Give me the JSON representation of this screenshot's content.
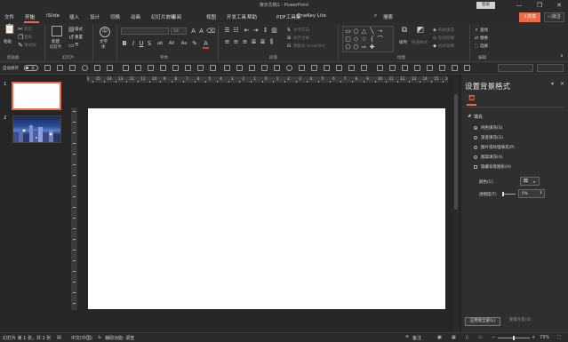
{
  "window": {
    "title": "演示文稿1  -  PowerPoint",
    "login_label": "登录",
    "minimize": "—",
    "restore": "❐",
    "close": "✕"
  },
  "menu": {
    "tabs": [
      "文件",
      "开始",
      "iSlide",
      "插入",
      "设计",
      "切换",
      "动画",
      "幻灯片放映",
      "审阅",
      "视图",
      "开发工具",
      "帮助",
      "PDF工具集",
      "OneKey Lite"
    ],
    "search": "搜索",
    "share": "共享",
    "comment": "批注"
  },
  "ribbon": {
    "clipboard": {
      "group": "剪贴板",
      "paste": "粘贴",
      "cut": "剪切",
      "copy": "复制",
      "format_painter": "格式刷"
    },
    "slides": {
      "group": "幻灯片",
      "new_slide": "新建",
      "new_slide2": "幻灯片",
      "layout": "版式",
      "reset": "重置",
      "section": "节"
    },
    "textfont": {
      "label": "文字",
      "label2": "体"
    },
    "font": {
      "group": "字体",
      "font_name": "",
      "font_size": "18",
      "bold": "B",
      "italic": "I",
      "underline": "U",
      "strike": "S",
      "shadow": "ab",
      "spacing": "AV",
      "case": "Aa",
      "font_color": "A"
    },
    "paragraph": {
      "group": "段落",
      "text_direction": "文字方向",
      "align_text": "对齐文本",
      "smartart": "转换为 SmartArt"
    },
    "drawing": {
      "group": "绘图",
      "arrange": "排列",
      "quick_styles": "快速样式",
      "shape_fill": "形状填充",
      "shape_outline": "形状轮廓",
      "shape_effects": "形状效果"
    },
    "editing": {
      "group": "编辑",
      "find": "查找",
      "replace": "替换",
      "select": "选择"
    }
  },
  "qat": {
    "autosave": "自动保存",
    "toggle": "关"
  },
  "thumbnails": [
    {
      "number": "1"
    },
    {
      "number": "2"
    }
  ],
  "ruler": {
    "h_ticks": [
      "16",
      "15",
      "14",
      "13",
      "12",
      "11",
      "10",
      "9",
      "8",
      "7",
      "6",
      "5",
      "4",
      "3",
      "2",
      "1",
      "0",
      "1",
      "2",
      "3",
      "4",
      "5",
      "6",
      "7",
      "8",
      "9",
      "10",
      "11",
      "12",
      "13",
      "14",
      "15",
      "16"
    ]
  },
  "pane": {
    "title": "设置背景格式",
    "section": "填充",
    "options": [
      "纯色填充(S)",
      "渐变填充(G)",
      "图片或纹理填充(P)",
      "图案填充(A)"
    ],
    "selected_option": 0,
    "hide_bg": "隐藏背景图形(H)",
    "color_label": "颜色(C)",
    "transparency_label": "透明度(T)",
    "transparency_value": "0%",
    "apply_all": "应用到全部(L)",
    "reset_bg": "重置背景(B)"
  },
  "status": {
    "slide_info": "幻灯片 第 1 张，共 2 张",
    "language": "中文(中国)",
    "accessibility": "辅助功能: 调查",
    "notes": "备注",
    "zoom": "73%"
  },
  "colors": {
    "accent": "#ec6b46",
    "bg": "#262626",
    "slide": "#ffffff"
  }
}
